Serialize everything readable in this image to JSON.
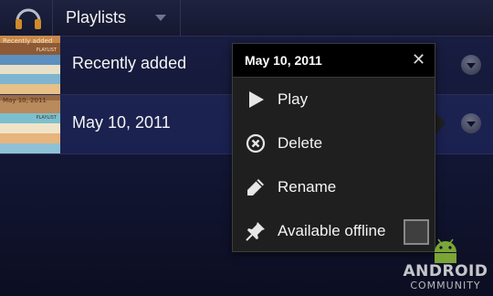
{
  "action_bar": {
    "app_icon": "headphones-icon",
    "title": "Playlists",
    "dropdown_icon": "caret-down-icon"
  },
  "playlists": [
    {
      "label": "Recently added",
      "thumb_text": "Recently added",
      "thumb_sub": "PLAYLIST",
      "overflow_icon": "overflow-caret-icon"
    },
    {
      "label": "May 10, 2011",
      "thumb_text": "May 10, 2011",
      "thumb_sub": "PLAYLIST",
      "overflow_icon": "overflow-caret-icon",
      "selected": true
    }
  ],
  "popup": {
    "title": "May 10, 2011",
    "close_icon": "close-icon",
    "items": [
      {
        "label": "Play",
        "icon": "play-icon"
      },
      {
        "label": "Delete",
        "icon": "delete-icon"
      },
      {
        "label": "Rename",
        "icon": "pencil-icon"
      },
      {
        "label": "Available offline",
        "icon": "pin-icon",
        "checkbox_checked": false
      }
    ]
  },
  "watermark": {
    "line1": "ANDROID",
    "line2": "COMMUNITY"
  },
  "colors": {
    "background": "#121633",
    "popup_background": "#1f1f1f",
    "popup_header": "#000000",
    "selected_row": "#1c2350"
  }
}
